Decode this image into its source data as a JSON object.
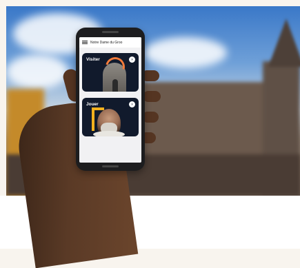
{
  "app": {
    "title": "Notre Dame du Groo"
  },
  "cards": [
    {
      "label": "Visiter",
      "arrow": "›"
    },
    {
      "label": "Jouer",
      "arrow": "›"
    }
  ],
  "colors": {
    "card_bg": "#111a2c",
    "accent_orange": "#f27b3b",
    "accent_yellow": "#f2b01e"
  },
  "icons": {
    "menu": "hamburger-menu-icon",
    "arrow": "chevron-right-icon"
  }
}
